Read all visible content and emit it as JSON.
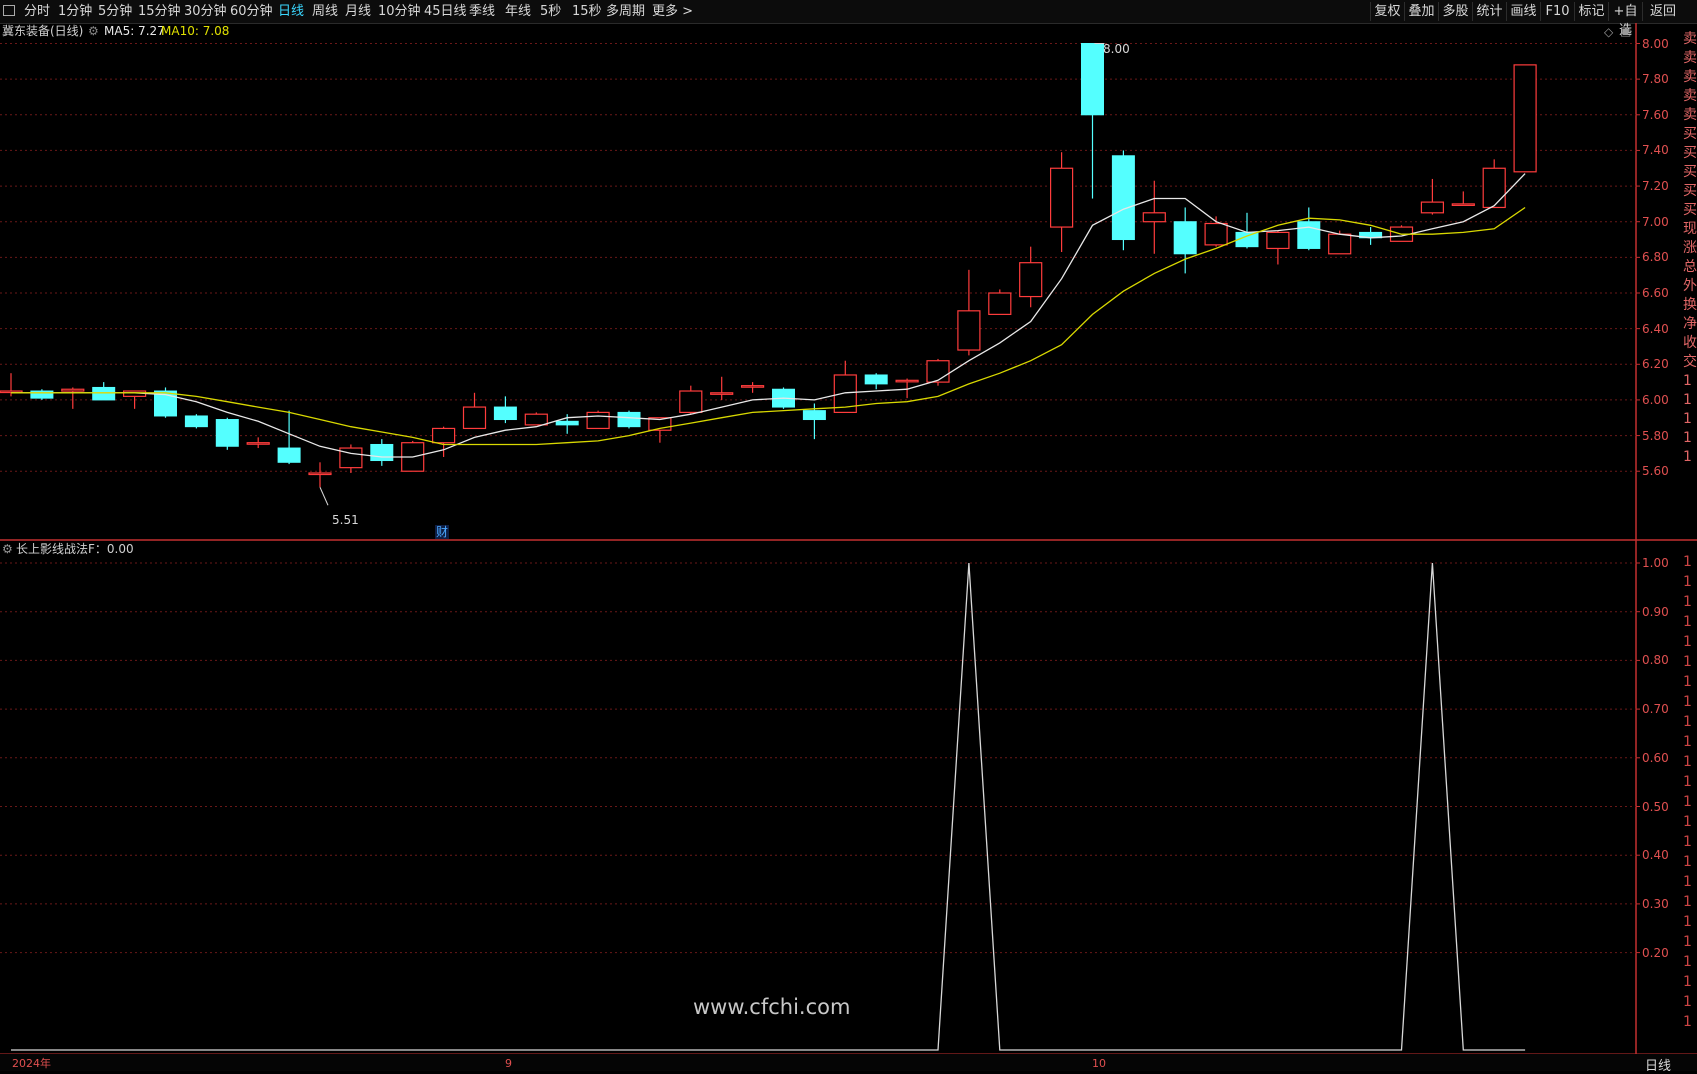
{
  "toolbar": {
    "periods": [
      {
        "label": "分时"
      },
      {
        "label": "1分钟"
      },
      {
        "label": "5分钟"
      },
      {
        "label": "15分钟"
      },
      {
        "label": "30分钟"
      },
      {
        "label": "60分钟"
      },
      {
        "label": "日线"
      },
      {
        "label": "周线"
      },
      {
        "label": "月线"
      },
      {
        "label": "10分钟"
      },
      {
        "label": "45日线"
      },
      {
        "label": "季线"
      },
      {
        "label": "年线"
      },
      {
        "label": "5秒"
      },
      {
        "label": "15秒"
      },
      {
        "label": "多周期"
      },
      {
        "label": "更多 >"
      }
    ],
    "active_period": "日线",
    "right_buttons": [
      {
        "label": "复权"
      },
      {
        "label": "叠加"
      },
      {
        "label": "多股"
      },
      {
        "label": "统计"
      },
      {
        "label": "画线"
      },
      {
        "label": "F10"
      },
      {
        "label": "标记"
      },
      {
        "label": "+自选"
      },
      {
        "label": "返回"
      }
    ]
  },
  "main_pane": {
    "stock_title": "冀东装备(日线)",
    "ma5_label": "MA5: 7.27",
    "ma10_label": "MA10: 7.08",
    "high_marker": "8.00",
    "low_marker": "5.51",
    "finance_badge": "财"
  },
  "indicator_pane": {
    "title": "长上影线战法F：0.00"
  },
  "right_panel_cut": [
    "卖",
    "卖",
    "卖",
    "卖",
    "卖",
    "买",
    "买",
    "买",
    "买",
    "买",
    "现",
    "涨",
    "总",
    "外",
    "换",
    "净",
    "收",
    "交",
    "1",
    "1",
    "1",
    "1",
    "1"
  ],
  "x_axis": {
    "labels": [
      {
        "text": "2024年"
      },
      {
        "text": "9"
      },
      {
        "text": "10"
      }
    ]
  },
  "status": {
    "period_label": "日线"
  },
  "watermark": "www.cfchi.com",
  "colors": {
    "up": "#ff3c3c",
    "down": "#54ffff",
    "ma5": "#e8e8e8",
    "ma10": "#d8d800",
    "grid": "#6a1818",
    "axis": "#c43030",
    "active_tab": "#3ad7ff"
  },
  "chart_data": [
    {
      "type": "candlestick",
      "title": "冀东装备(日线)",
      "ylim": [
        5.4,
        8.05
      ],
      "y_ticks": [
        "8.00",
        "7.80",
        "7.60",
        "7.40",
        "7.20",
        "7.00",
        "6.80",
        "6.60",
        "6.40",
        "6.20",
        "6.00",
        "5.80",
        "5.60"
      ],
      "candles": [
        {
          "o": 6.05,
          "h": 6.15,
          "l": 6.02,
          "c": 6.05
        },
        {
          "o": 6.05,
          "h": 6.06,
          "l": 6.0,
          "c": 6.01
        },
        {
          "o": 6.05,
          "h": 6.07,
          "l": 5.95,
          "c": 6.06
        },
        {
          "o": 6.07,
          "h": 6.1,
          "l": 6.0,
          "c": 6.0
        },
        {
          "o": 6.02,
          "h": 6.05,
          "l": 5.95,
          "c": 6.05
        },
        {
          "o": 6.05,
          "h": 6.07,
          "l": 5.9,
          "c": 5.91
        },
        {
          "o": 5.91,
          "h": 5.92,
          "l": 5.84,
          "c": 5.85
        },
        {
          "o": 5.89,
          "h": 5.9,
          "l": 5.72,
          "c": 5.74
        },
        {
          "o": 5.76,
          "h": 5.79,
          "l": 5.73,
          "c": 5.76
        },
        {
          "o": 5.73,
          "h": 5.94,
          "l": 5.64,
          "c": 5.65
        },
        {
          "o": 5.59,
          "h": 5.65,
          "l": 5.51,
          "c": 5.59
        },
        {
          "o": 5.62,
          "h": 5.75,
          "l": 5.59,
          "c": 5.73
        },
        {
          "o": 5.75,
          "h": 5.78,
          "l": 5.63,
          "c": 5.66
        },
        {
          "o": 5.6,
          "h": 5.77,
          "l": 5.6,
          "c": 5.76
        },
        {
          "o": 5.76,
          "h": 5.85,
          "l": 5.68,
          "c": 5.84
        },
        {
          "o": 5.84,
          "h": 6.04,
          "l": 5.84,
          "c": 5.96
        },
        {
          "o": 5.96,
          "h": 6.02,
          "l": 5.87,
          "c": 5.89
        },
        {
          "o": 5.86,
          "h": 5.93,
          "l": 5.86,
          "c": 5.92
        },
        {
          "o": 5.88,
          "h": 5.92,
          "l": 5.81,
          "c": 5.86
        },
        {
          "o": 5.84,
          "h": 5.94,
          "l": 5.84,
          "c": 5.93
        },
        {
          "o": 5.93,
          "h": 5.94,
          "l": 5.84,
          "c": 5.85
        },
        {
          "o": 5.83,
          "h": 5.88,
          "l": 5.76,
          "c": 5.9
        },
        {
          "o": 5.93,
          "h": 6.08,
          "l": 5.92,
          "c": 6.05
        },
        {
          "o": 6.04,
          "h": 6.13,
          "l": 6.0,
          "c": 6.04
        },
        {
          "o": 6.08,
          "h": 6.1,
          "l": 6.04,
          "c": 6.08
        },
        {
          "o": 6.06,
          "h": 6.07,
          "l": 5.95,
          "c": 5.96
        },
        {
          "o": 5.94,
          "h": 5.98,
          "l": 5.78,
          "c": 5.89
        },
        {
          "o": 5.93,
          "h": 6.22,
          "l": 5.93,
          "c": 6.14
        },
        {
          "o": 6.14,
          "h": 6.15,
          "l": 6.06,
          "c": 6.09
        },
        {
          "o": 6.11,
          "h": 6.12,
          "l": 6.01,
          "c": 6.11
        },
        {
          "o": 6.1,
          "h": 6.23,
          "l": 6.08,
          "c": 6.22
        },
        {
          "o": 6.28,
          "h": 6.73,
          "l": 6.25,
          "c": 6.5
        },
        {
          "o": 6.48,
          "h": 6.62,
          "l": 6.48,
          "c": 6.6
        },
        {
          "o": 6.58,
          "h": 6.86,
          "l": 6.52,
          "c": 6.77
        },
        {
          "o": 6.97,
          "h": 7.39,
          "l": 6.83,
          "c": 7.3
        },
        {
          "o": 8.0,
          "h": 8.0,
          "l": 7.13,
          "c": 7.6
        },
        {
          "o": 7.37,
          "h": 7.4,
          "l": 6.84,
          "c": 6.9
        },
        {
          "o": 7.0,
          "h": 7.23,
          "l": 6.82,
          "c": 7.05
        },
        {
          "o": 7.0,
          "h": 7.08,
          "l": 6.71,
          "c": 6.82
        },
        {
          "o": 6.87,
          "h": 7.03,
          "l": 6.86,
          "c": 6.99
        },
        {
          "o": 6.94,
          "h": 7.05,
          "l": 6.85,
          "c": 6.86
        },
        {
          "o": 6.85,
          "h": 6.95,
          "l": 6.76,
          "c": 6.94
        },
        {
          "o": 7.0,
          "h": 7.08,
          "l": 6.84,
          "c": 6.85
        },
        {
          "o": 6.82,
          "h": 6.95,
          "l": 6.82,
          "c": 6.93
        },
        {
          "o": 6.94,
          "h": 6.97,
          "l": 6.87,
          "c": 6.91
        },
        {
          "o": 6.89,
          "h": 6.98,
          "l": 6.89,
          "c": 6.97
        },
        {
          "o": 7.05,
          "h": 7.24,
          "l": 7.04,
          "c": 7.11
        },
        {
          "o": 7.1,
          "h": 7.17,
          "l": 7.1,
          "c": 7.1
        },
        {
          "o": 7.08,
          "h": 7.35,
          "l": 7.08,
          "c": 7.3
        },
        {
          "o": 7.28,
          "h": 7.88,
          "l": 7.28,
          "c": 7.88
        }
      ],
      "series": [
        {
          "name": "MA5",
          "values": [
            6.04,
            6.04,
            6.04,
            6.04,
            6.04,
            6.03,
            5.99,
            5.93,
            5.88,
            5.81,
            5.74,
            5.7,
            5.68,
            5.68,
            5.72,
            5.79,
            5.83,
            5.85,
            5.9,
            5.91,
            5.9,
            5.89,
            5.92,
            5.96,
            6.0,
            6.01,
            6.0,
            6.04,
            6.05,
            6.06,
            6.11,
            6.22,
            6.32,
            6.44,
            6.68,
            6.98,
            7.07,
            7.13,
            7.13,
            7.0,
            6.94,
            6.95,
            6.97,
            6.93,
            6.91,
            6.92,
            6.96,
            7.0,
            7.09,
            7.27
          ]
        },
        {
          "name": "MA10",
          "values": [
            6.04,
            6.04,
            6.04,
            6.04,
            6.04,
            6.04,
            6.02,
            5.99,
            5.96,
            5.93,
            5.89,
            5.85,
            5.82,
            5.79,
            5.75,
            5.75,
            5.75,
            5.75,
            5.76,
            5.77,
            5.8,
            5.84,
            5.87,
            5.9,
            5.93,
            5.94,
            5.95,
            5.96,
            5.98,
            5.99,
            6.02,
            6.09,
            6.15,
            6.22,
            6.31,
            6.48,
            6.61,
            6.71,
            6.79,
            6.85,
            6.92,
            6.98,
            7.02,
            7.01,
            6.98,
            6.93,
            6.93,
            6.94,
            6.96,
            7.08
          ]
        }
      ]
    },
    {
      "type": "line",
      "title": "长上影线战法F：0.00",
      "ylim": [
        0,
        1.0
      ],
      "y_ticks": [
        "1.00",
        "0.90",
        "0.80",
        "0.70",
        "0.60",
        "0.50",
        "0.40",
        "0.30",
        "0.20"
      ],
      "series": [
        {
          "name": "长上影线战法F",
          "values": [
            0,
            0,
            0,
            0,
            0,
            0,
            0,
            0,
            0,
            0,
            0,
            0,
            0,
            0,
            0,
            0,
            0,
            0,
            0,
            0,
            0,
            0,
            0,
            0,
            0,
            0,
            0,
            0,
            0,
            0,
            0,
            1,
            0,
            0,
            0,
            0,
            0,
            0,
            0,
            0,
            0,
            0,
            0,
            0,
            0,
            0,
            1,
            0,
            0,
            0
          ]
        }
      ]
    }
  ]
}
